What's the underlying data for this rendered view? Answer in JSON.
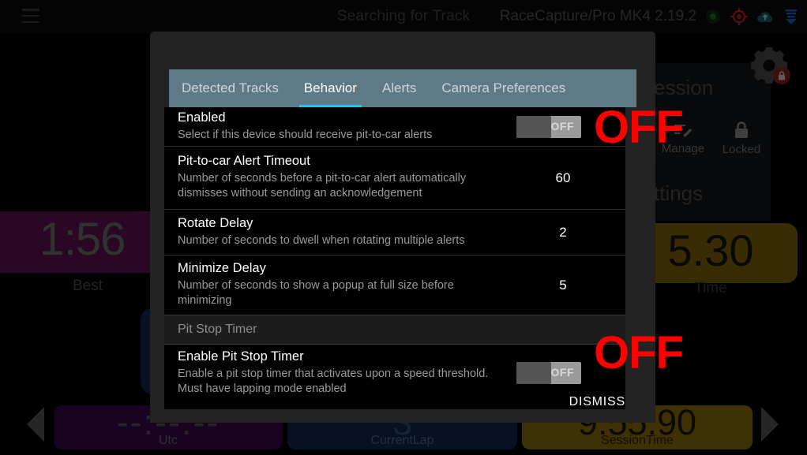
{
  "topbar": {
    "menu_icon": "hamburger-menu-icon",
    "title": "Searching for Track",
    "device": "RaceCapture/Pro MK4 2.19.2",
    "icons": [
      {
        "name": "gps-status-icon",
        "color": "#1f6b2a"
      },
      {
        "name": "track-target-icon",
        "color": "#c42020"
      },
      {
        "name": "cloud-upload-icon",
        "color": "#1a5a66"
      },
      {
        "name": "telemetry-signal-icon",
        "color": "#1b5fb5"
      }
    ]
  },
  "background": {
    "best_tile": {
      "value": "1:56",
      "label": "Best",
      "color": "#5d1350"
    },
    "gold_tile": {
      "value": "5.30",
      "label": "Time",
      "color": "#7a6208"
    },
    "side_panel": {
      "title": "ession",
      "footer": "ttings",
      "cells": [
        {
          "icon": "manage-edit-icon",
          "label": "Manage"
        },
        {
          "icon": "lock-icon",
          "label": "Locked"
        }
      ],
      "gear_icon": "gear-locked-icon"
    },
    "bottom_tiles": [
      {
        "value": "--:--:--",
        "label": "Utc",
        "color": "#36084a"
      },
      {
        "value": "3",
        "label": "CurrentLap",
        "color": "#12264f"
      },
      {
        "value": "9:55.90",
        "label": "SessionTime",
        "color": "#8a6d08"
      }
    ],
    "nav_left_icon": "chevron-left-icon",
    "nav_right_icon": "chevron-right-icon"
  },
  "dialog": {
    "tabs": [
      {
        "label": "Detected Tracks",
        "active": false
      },
      {
        "label": "Behavior",
        "active": true
      },
      {
        "label": "Alerts",
        "active": false
      },
      {
        "label": "Camera Preferences",
        "active": false
      }
    ],
    "accent_color": "#1ec8e8",
    "tabbar_color": "#5f7a87",
    "rows": [
      {
        "type": "toggle",
        "title": "Enabled",
        "desc": "Select if this device should receive pit-to-car alerts",
        "toggle_label": "OFF",
        "overlay_label": "OFF",
        "overlay_color": "#ff0000"
      },
      {
        "type": "value",
        "title": "Pit-to-car Alert Timeout",
        "desc": "Number of seconds before a pit-to-car alert automatically dismisses without sending an acknowledgement",
        "value": "60"
      },
      {
        "type": "value",
        "title": "Rotate Delay",
        "desc": "Number of seconds to dwell when rotating multiple alerts",
        "value": "2"
      },
      {
        "type": "value",
        "title": "Minimize Delay",
        "desc": "Number of seconds to show a popup at full size before minimizing",
        "value": "5"
      },
      {
        "type": "section",
        "title": "Pit Stop Timer"
      },
      {
        "type": "toggle",
        "title": "Enable Pit Stop Timer",
        "desc": "Enable a pit stop timer that activates upon a speed threshold. Must have lapping mode enabled",
        "toggle_label": "OFF",
        "overlay_label": "OFF",
        "overlay_color": "#ff0000"
      }
    ],
    "dismiss_label": "DISMISS"
  }
}
